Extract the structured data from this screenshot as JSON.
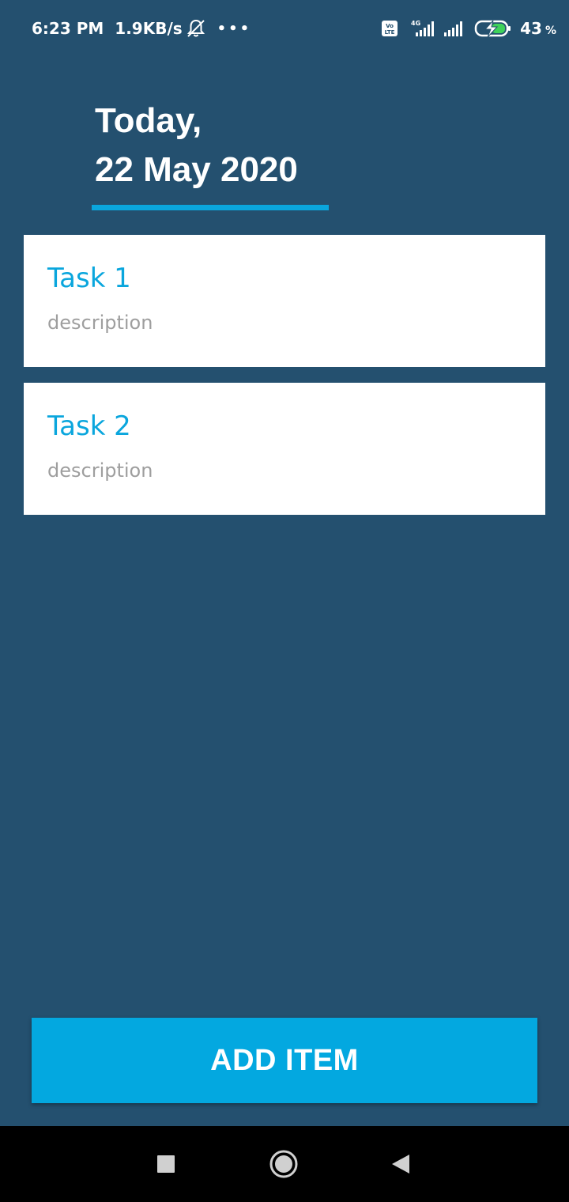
{
  "status_bar": {
    "time": "6:23 PM",
    "net_speed": "1.9KB/s",
    "more_dots": "•••",
    "network_4g": "4G",
    "battery_percent": "43",
    "percent_sign": "%",
    "icons": [
      "mute-bell-icon",
      "volte-icon",
      "signal-4g-icon",
      "signal-icon",
      "battery-charging-icon"
    ]
  },
  "header": {
    "line1": "Today,",
    "line2": "22 May 2020",
    "accent_color": "#0aa6dd"
  },
  "tasks": [
    {
      "title": "Task 1",
      "description": "description"
    },
    {
      "title": "Task 2",
      "description": "description"
    }
  ],
  "add_button": {
    "label": "ADD ITEM",
    "color": "#03a8e0"
  },
  "nav_bar": {
    "icons": [
      "recent-apps-icon",
      "home-icon",
      "back-icon"
    ]
  },
  "colors": {
    "background": "#24506f",
    "card": "#ffffff",
    "description": "#9e9e9e"
  }
}
